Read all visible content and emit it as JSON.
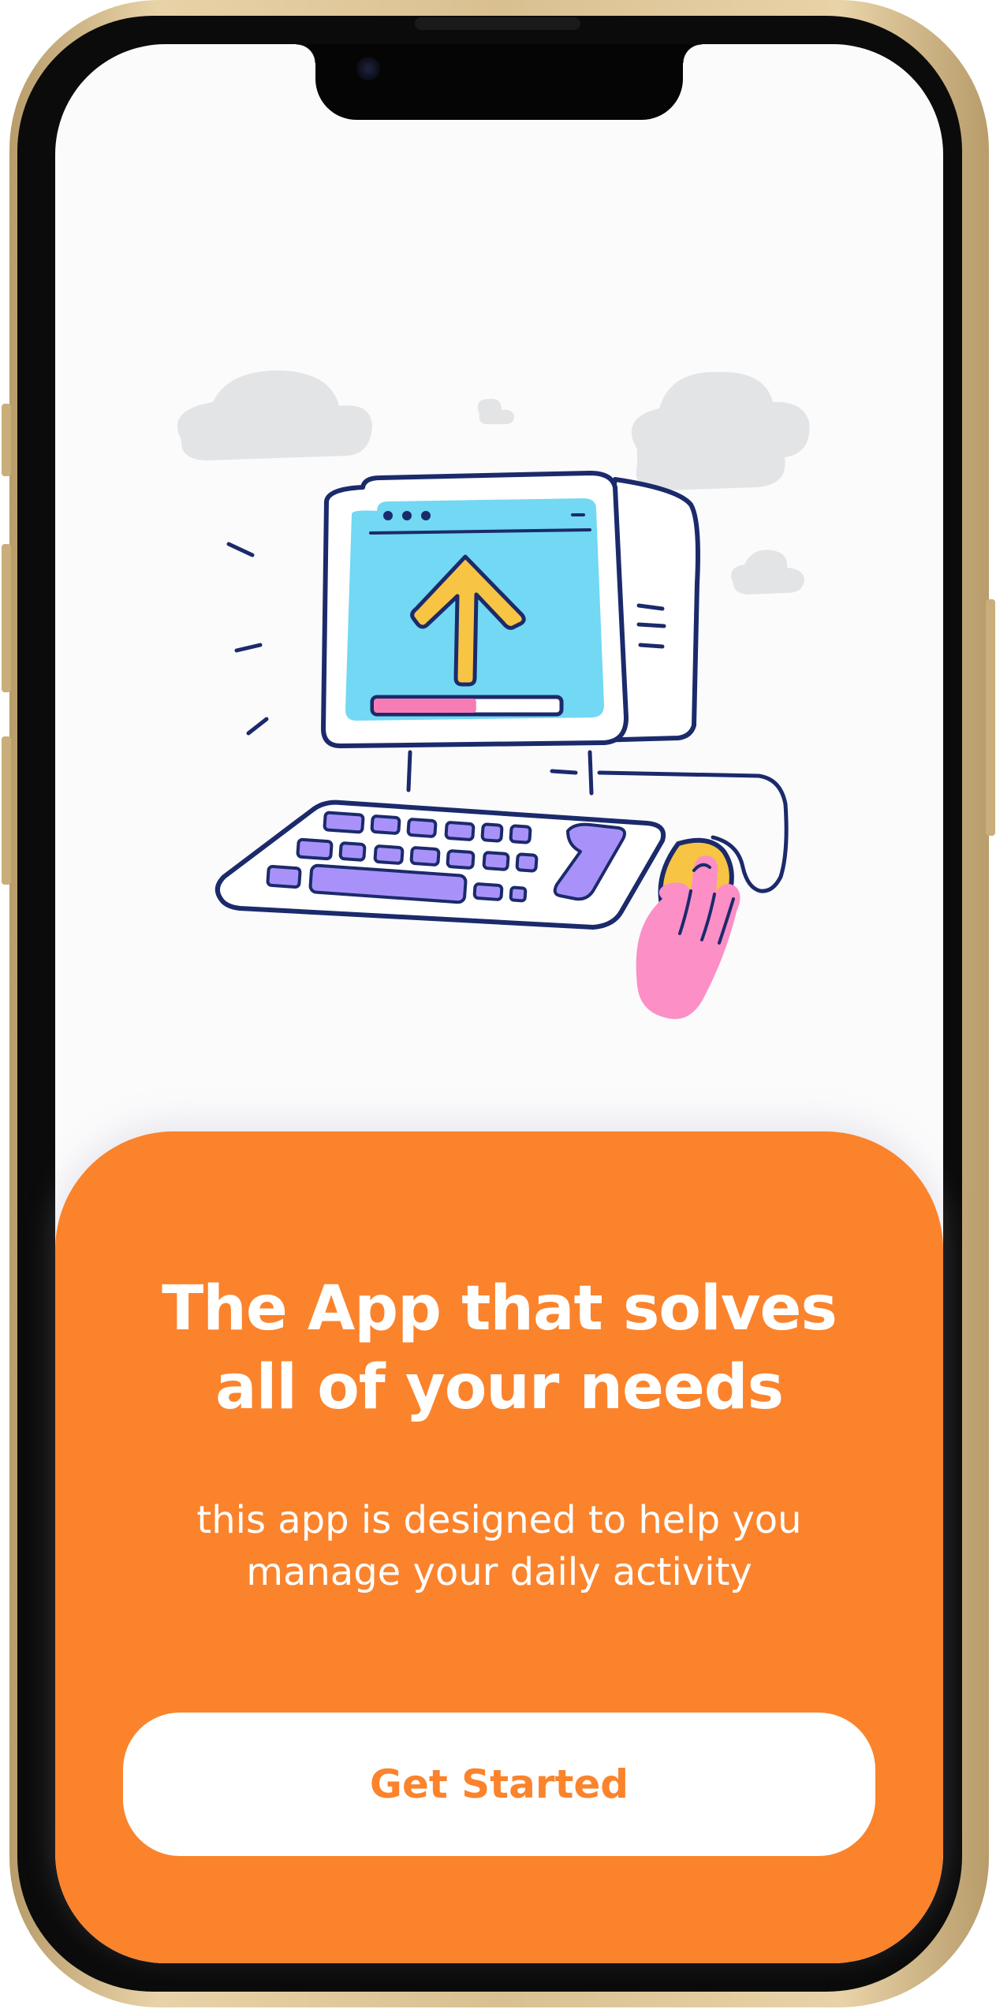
{
  "onboarding": {
    "headline_line1": "The App that solves",
    "headline_line2": "all of your needs",
    "subtitle_line1": "this app is designed to help you",
    "subtitle_line2": "manage your daily activity",
    "cta_label": "Get Started"
  },
  "illustration": {
    "subject": "computer-upload-illustration",
    "upload_progress": 0.55
  },
  "colors": {
    "accent": "#fb832c",
    "screen_bg": "#fbfbfc",
    "monitor_screen": "#72d8f3",
    "arrow": "#f7c444",
    "keys": "#a892fa",
    "hand": "#fb8fc6",
    "cloud": "#e3e4e5",
    "outline": "#1b2a6b"
  }
}
